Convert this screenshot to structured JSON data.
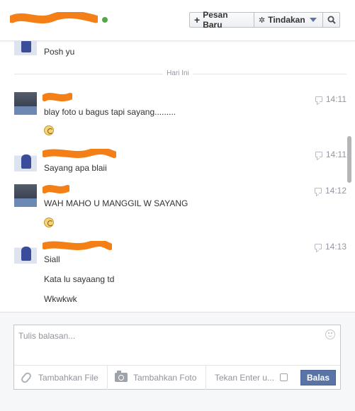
{
  "header": {
    "new_message_label": "Pesan Baru",
    "new_message_icon": "plus-icon",
    "actions_label": "Tindakan",
    "actions_icon": "gear-icon",
    "search_icon": "search-icon",
    "online_color": "#55a74b"
  },
  "thread": {
    "prior_message": "Posh yu",
    "day_divider": "Hari Ini",
    "messages": [
      {
        "time": "14:11",
        "lines": [
          "blay foto u bagus tapi sayang........."
        ],
        "sticker": true
      },
      {
        "time": "14:11",
        "lines": [
          "Sayang apa blaii"
        ],
        "sticker": false
      },
      {
        "time": "14:12",
        "lines": [
          "WAH MAHO U MANGGIL W SAYANG"
        ],
        "sticker": true
      },
      {
        "time": "14:13",
        "lines": [
          "Siall",
          "Kata lu sayaang td",
          "Wkwkwk"
        ],
        "sticker": false
      }
    ]
  },
  "composer": {
    "placeholder": "Tulis balasan...",
    "add_file_label": "Tambahkan File",
    "add_photo_label": "Tambahkan Foto",
    "press_enter_label": "Tekan Enter u...",
    "send_label": "Balas",
    "accent_color": "#5b74a8"
  }
}
